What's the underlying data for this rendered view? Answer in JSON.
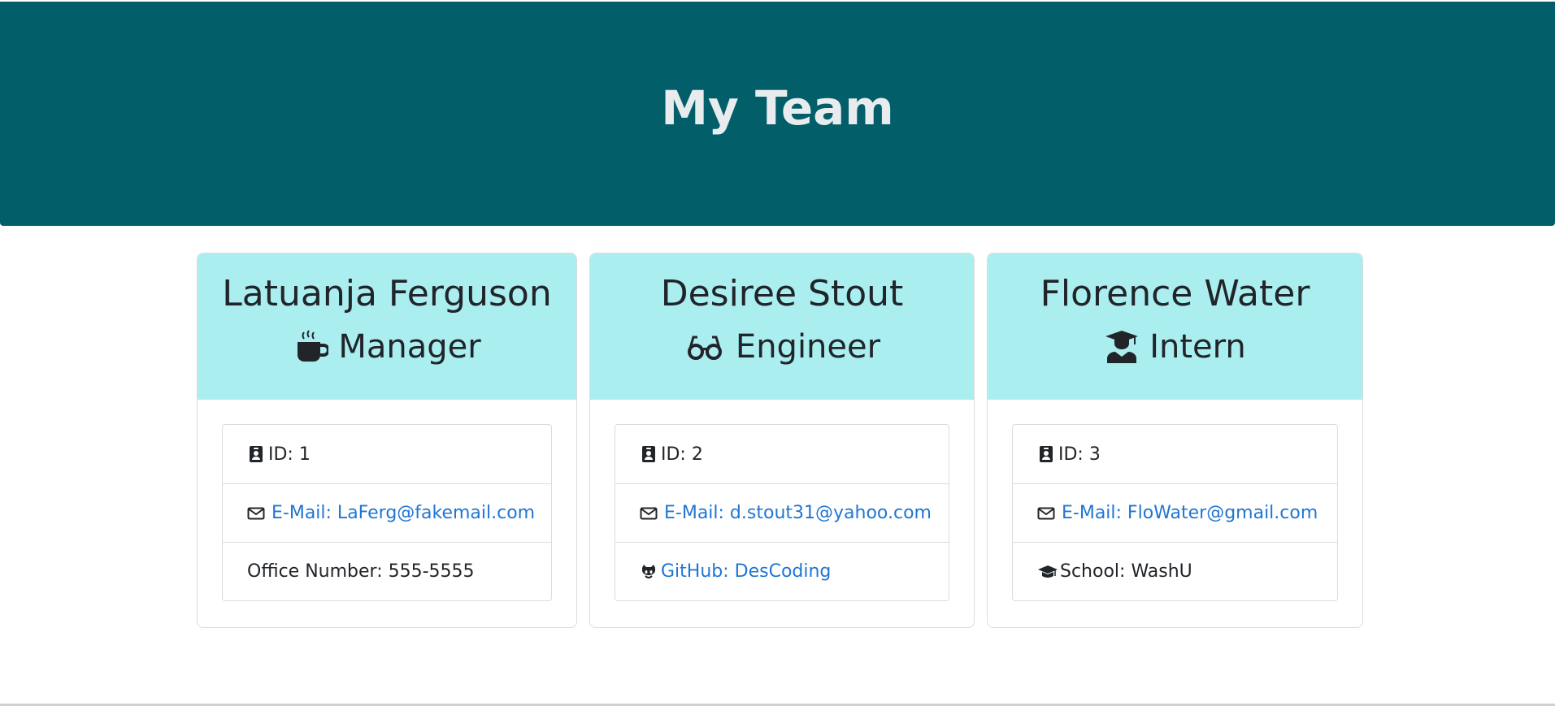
{
  "header": {
    "title": "My Team"
  },
  "cards": [
    {
      "name": "Latuanja Ferguson",
      "role": "Manager",
      "role_icon": "mug-icon",
      "id_text": "ID: 1",
      "email_text": "E-Mail: LaFerg@fakemail.com",
      "extra_text": "Office Number: 555-5555"
    },
    {
      "name": "Desiree Stout",
      "role": "Engineer",
      "role_icon": "glasses-icon",
      "id_text": "ID: 2",
      "email_text": "E-Mail: d.stout31@yahoo.com",
      "extra_text": "GitHub: DesCoding"
    },
    {
      "name": "Florence Water",
      "role": "Intern",
      "role_icon": "graduate-icon",
      "id_text": "ID: 3",
      "email_text": "E-Mail: FloWater@gmail.com",
      "extra_text": "School: WashU"
    }
  ],
  "colors": {
    "header_bg": "#025e68",
    "card_head_bg": "#aaeef0",
    "link": "#2176d2"
  }
}
